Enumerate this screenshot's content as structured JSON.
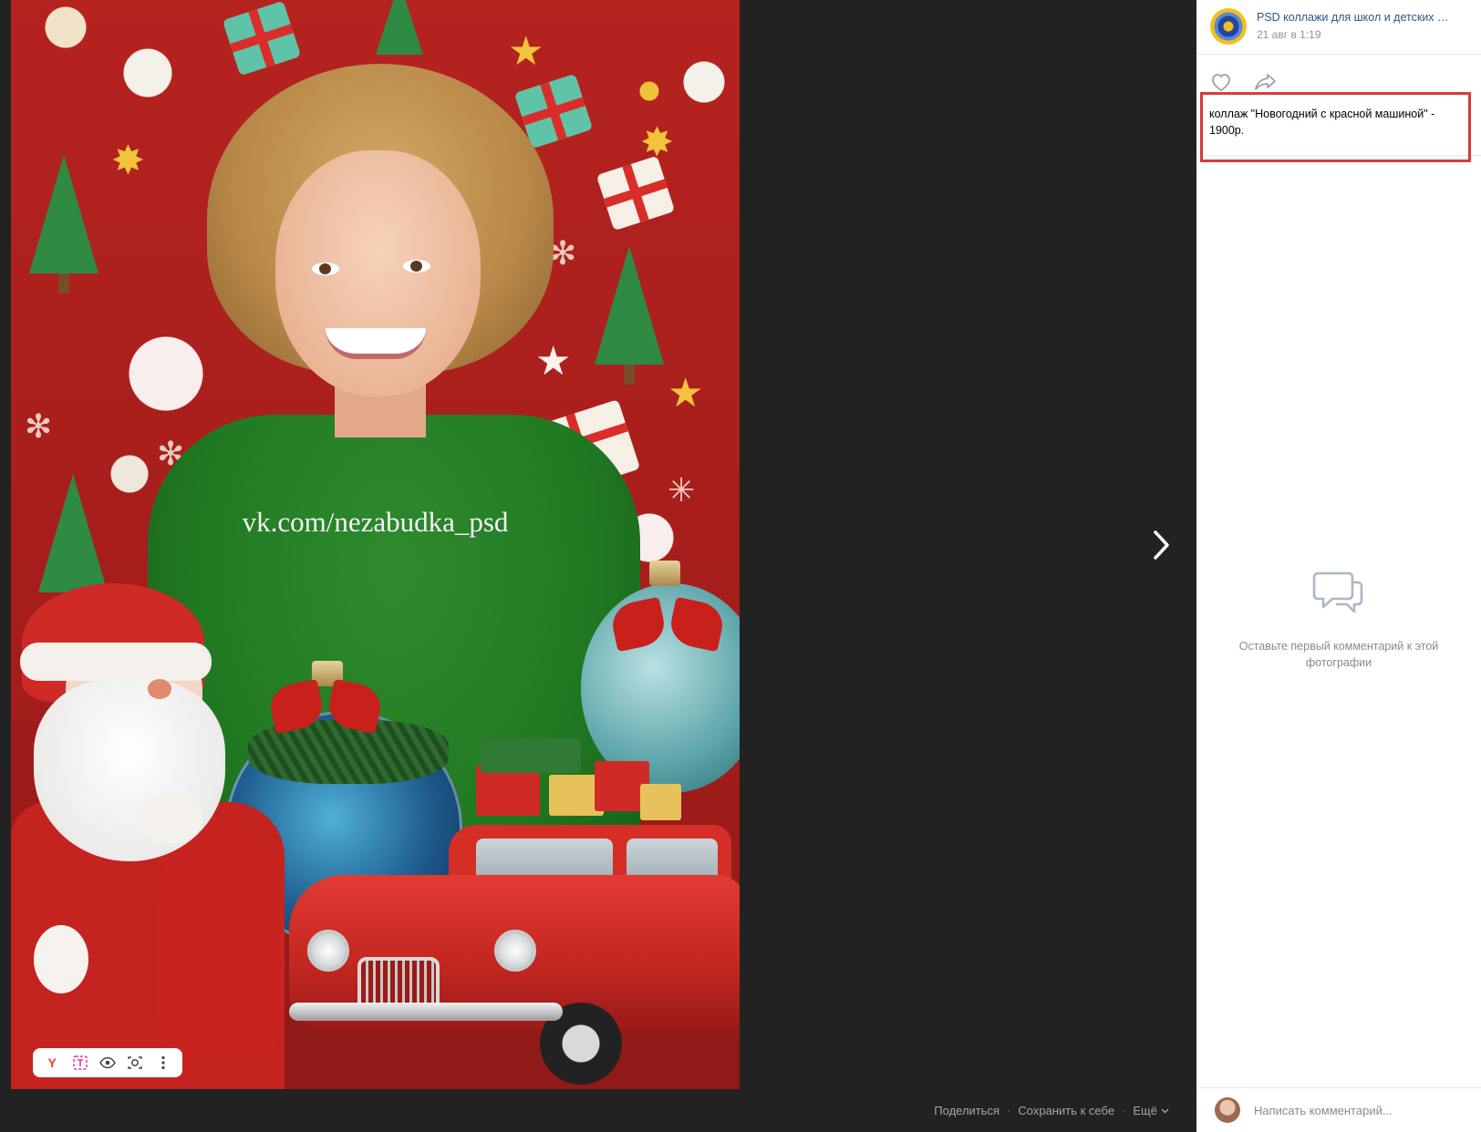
{
  "photo": {
    "watermark": "vk.com/nezabudka_psd"
  },
  "image_toolbar": {
    "yandex_label": "Y",
    "icons": [
      "yandex-icon",
      "translate-text-icon",
      "eye-icon",
      "camera-search-icon",
      "more-vertical-icon"
    ]
  },
  "bottom_bar": {
    "share": "Поделиться",
    "save": "Сохранить к себе",
    "more": "Ещё",
    "separator": "·"
  },
  "panel": {
    "group_name": "PSD коллажи для школ и детских …",
    "date": "21 авг в 1:19",
    "caption": "коллаж \"Новогодний с красной машиной\" - 1900р.",
    "empty_comments": "Оставьте первый комментарий к этой фотографии",
    "comment_placeholder": "Написать комментарий...",
    "highlight_color": "#d93a3a",
    "link_color": "#2a5885"
  }
}
